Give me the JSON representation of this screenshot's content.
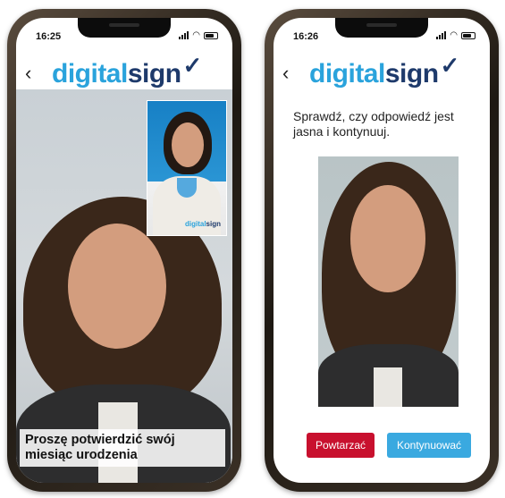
{
  "left_phone": {
    "status_time": "16:25",
    "logo": {
      "part1": "digital",
      "part2": "sign",
      "check": "✓"
    },
    "back_icon": "‹",
    "pip_logo": {
      "part1": "digital",
      "part2": "sign"
    },
    "caption": "Proszę potwierdzić swój miesiąc urodzenia"
  },
  "right_phone": {
    "status_time": "16:26",
    "logo": {
      "part1": "digital",
      "part2": "sign",
      "check": "✓"
    },
    "back_icon": "‹",
    "prompt": "Sprawdź, czy odpowiedź jest jasna i kontynuuj.",
    "buttons": {
      "retry": "Powtarzać",
      "continue": "Kontynuować"
    }
  },
  "colors": {
    "brand_light_blue": "#2aa3dc",
    "brand_dark_blue": "#1e3a6b",
    "retry_button": "#c8102e",
    "continue_button": "#3aa9e0"
  }
}
